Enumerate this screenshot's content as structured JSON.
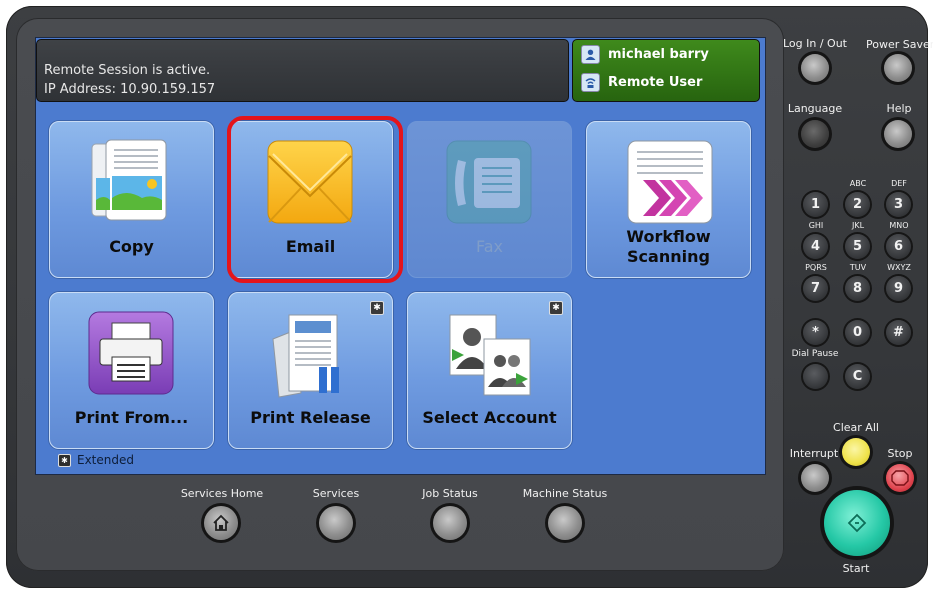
{
  "status": {
    "line1": "Remote Session is active.",
    "line2": "IP Address: 10.90.159.157"
  },
  "user": {
    "name": "michael barry",
    "role": "Remote User",
    "box_color": "#2f7414"
  },
  "tiles": [
    {
      "label": "Copy",
      "icon": "copy-icon",
      "enabled": true
    },
    {
      "label": "Email",
      "icon": "email-envelope-icon",
      "enabled": true,
      "selected": true
    },
    {
      "label": "Fax",
      "icon": "fax-icon",
      "enabled": false
    },
    {
      "label_line1": "Workflow",
      "label_line2": "Scanning",
      "icon": "workflow-scanning-icon",
      "enabled": true
    },
    {
      "label": "Print From...",
      "icon": "printer-icon",
      "enabled": true
    },
    {
      "label": "Print Release",
      "icon": "print-release-icon",
      "enabled": true,
      "extended": true
    },
    {
      "label": "Select Account",
      "icon": "select-account-icon",
      "enabled": true,
      "extended": true
    }
  ],
  "legend": {
    "extended_label": "Extended"
  },
  "bottom_buttons": {
    "services_home": "Services Home",
    "services": "Services",
    "job_status": "Job Status",
    "machine_status": "Machine Status"
  },
  "side_buttons": {
    "log_in_out": "Log In / Out",
    "power_saver": "Power Saver",
    "language": "Language",
    "help": "Help",
    "dial_pause": "Dial Pause",
    "clear_all": "Clear All",
    "interrupt": "Interrupt",
    "stop": "Stop",
    "start": "Start"
  },
  "keypad": {
    "keys": [
      "1",
      "2",
      "3",
      "4",
      "5",
      "6",
      "7",
      "8",
      "9",
      "*",
      "0",
      "#",
      "C"
    ],
    "letters": [
      "ABC",
      "DEF",
      "GHI",
      "JKL",
      "MNO",
      "PQRS",
      "TUV",
      "WXYZ"
    ]
  },
  "colors": {
    "screen_bg": "#4c7bcf",
    "highlight": "#e4141b",
    "clear_all": "#f3e95a",
    "stop": "#e0454f",
    "start": "#25c8a6"
  }
}
